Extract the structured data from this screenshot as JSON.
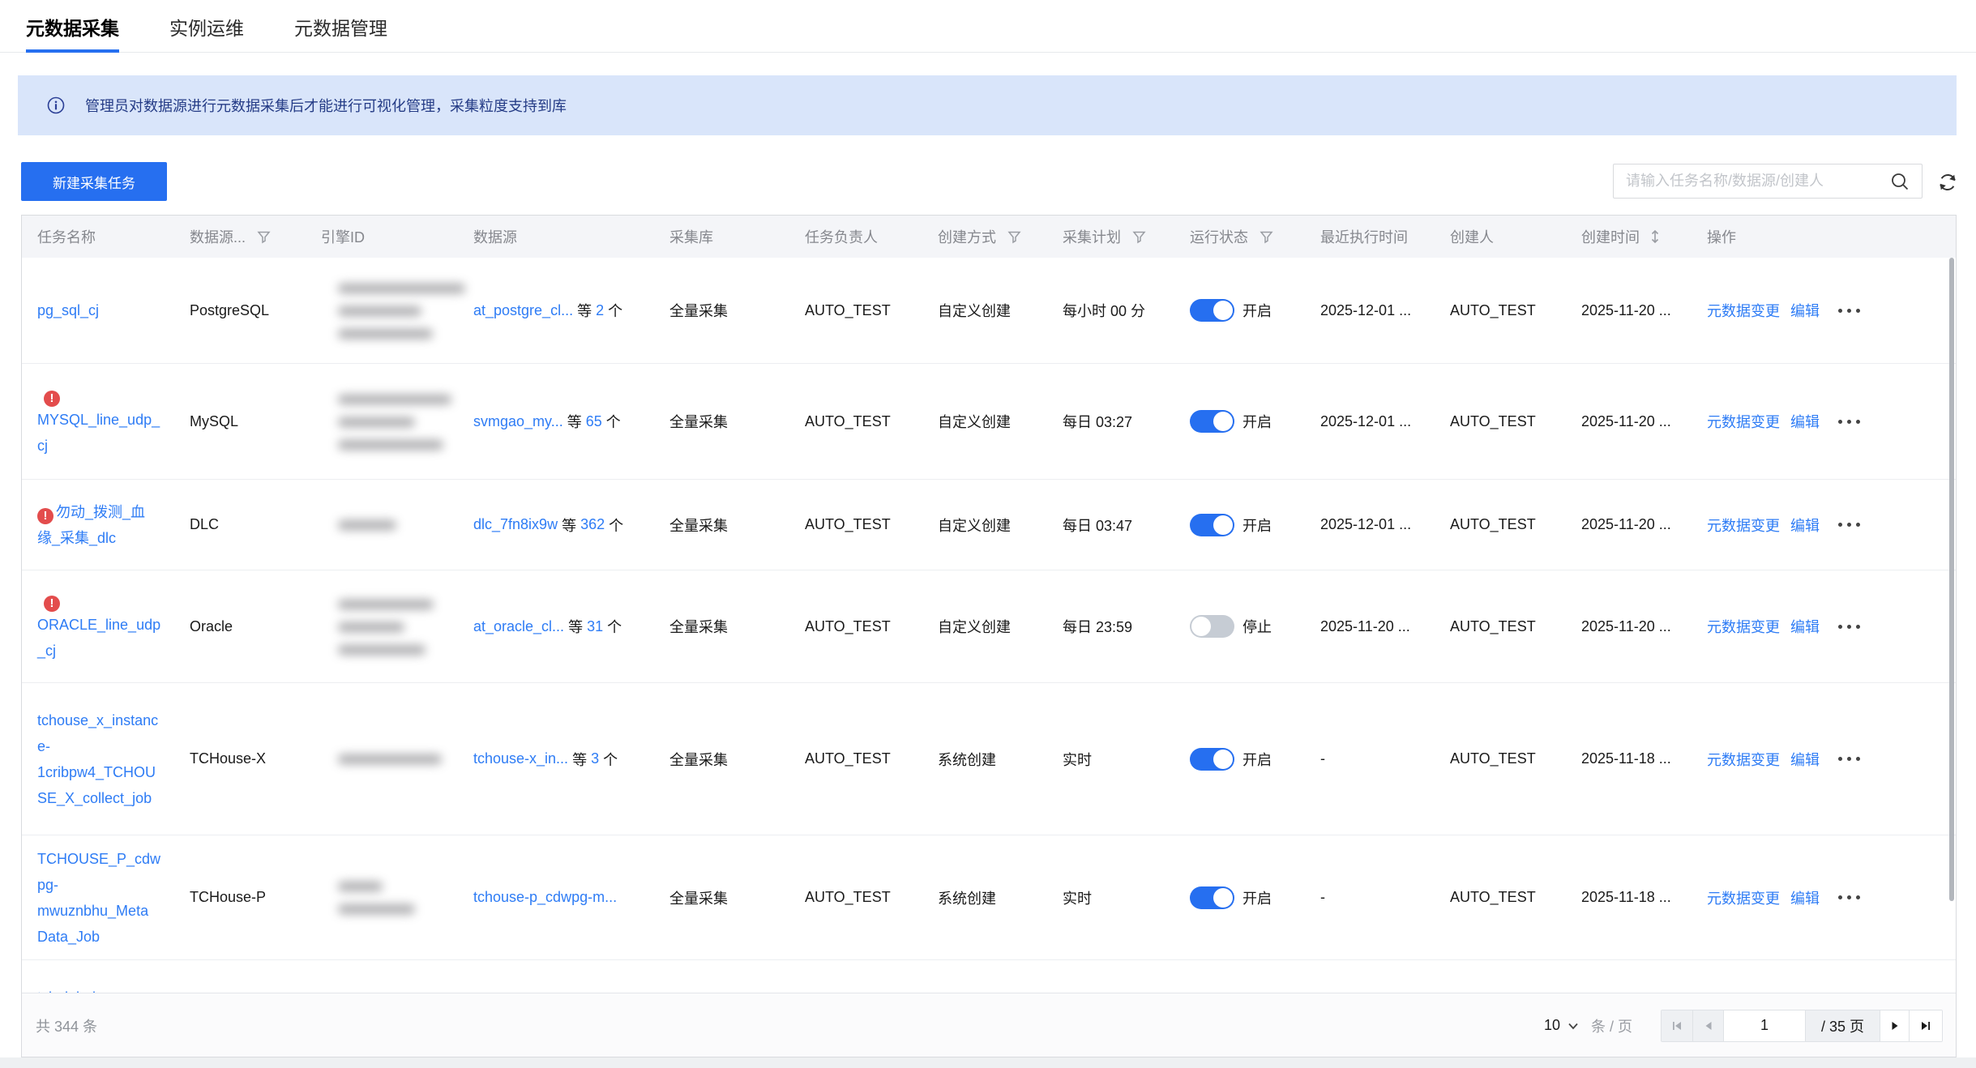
{
  "tabs": [
    {
      "label": "元数据采集",
      "active": true
    },
    {
      "label": "实例运维",
      "active": false
    },
    {
      "label": "元数据管理",
      "active": false
    }
  ],
  "banner": {
    "text": "管理员对数据源进行元数据采集后才能进行可视化管理，采集粒度支持到库"
  },
  "toolbar": {
    "new_task_label": "新建采集任务",
    "search_placeholder": "请输入任务名称/数据源/创建人"
  },
  "table": {
    "columns": [
      {
        "label": "任务名称"
      },
      {
        "label": "数据源...",
        "filter": true
      },
      {
        "label": "引擎ID"
      },
      {
        "label": "数据源"
      },
      {
        "label": "采集库"
      },
      {
        "label": "任务负责人"
      },
      {
        "label": "创建方式",
        "filter": true
      },
      {
        "label": "采集计划",
        "filter": true
      },
      {
        "label": "运行状态",
        "filter": true
      },
      {
        "label": "最近执行时间"
      },
      {
        "label": "创建人"
      },
      {
        "label": "创建时间",
        "sort": true
      },
      {
        "label": "操作"
      }
    ],
    "source_prefix": "等",
    "source_unit": "个",
    "ops": [
      "元数据变更",
      "编辑"
    ],
    "rows": [
      {
        "name": "pg_sql_cj",
        "error": "none",
        "type": "PostgreSQL",
        "blur": [
          157,
          103,
          117
        ],
        "source": "at_postgre_cl...",
        "count": "2",
        "db": "全量采集",
        "owner": "AUTO_TEST",
        "mode": "自定义创建",
        "plan": "每小时 00 分",
        "status_on": true,
        "status": "开启",
        "last": "2025-12-01 ...",
        "creator": "AUTO_TEST",
        "created": "2025-11-20 ..."
      },
      {
        "name": "MYSQL_line_udp_\ncj",
        "error": "above",
        "type": "MySQL",
        "blur": [
          140,
          95,
          130
        ],
        "source": "svmgao_my...",
        "count": "65",
        "db": "全量采集",
        "owner": "AUTO_TEST",
        "mode": "自定义创建",
        "plan": "每日 03:27",
        "status_on": true,
        "status": "开启",
        "last": "2025-12-01 ...",
        "creator": "AUTO_TEST",
        "created": "2025-11-20 ..."
      },
      {
        "name": "勿动_拨测_血\n缘_采集_dlc",
        "error": "inline",
        "type": "DLC",
        "blur": [
          72
        ],
        "source": "dlc_7fn8ix9w",
        "count": "362",
        "db": "全量采集",
        "owner": "AUTO_TEST",
        "mode": "自定义创建",
        "plan": "每日 03:47",
        "status_on": true,
        "status": "开启",
        "last": "2025-12-01 ...",
        "creator": "AUTO_TEST",
        "created": "2025-11-20 ..."
      },
      {
        "name": "ORACLE_line_udp\n_cj",
        "error": "above",
        "type": "Oracle",
        "blur": [
          118,
          82,
          108
        ],
        "source": "at_oracle_cl...",
        "count": "31",
        "db": "全量采集",
        "owner": "AUTO_TEST",
        "mode": "自定义创建",
        "plan": "每日 23:59",
        "status_on": false,
        "status": "停止",
        "last": "2025-11-20 ...",
        "creator": "AUTO_TEST",
        "created": "2025-11-20 ..."
      },
      {
        "name": "tchouse_x_instanc\ne-\n1cribpw4_TCHOU\nSE_X_collect_job",
        "error": "none",
        "type": "TCHouse-X",
        "blur": [
          128
        ],
        "source": "tchouse-x_in...",
        "count": "3",
        "db": "全量采集",
        "owner": "AUTO_TEST",
        "mode": "系统创建",
        "plan": "实时",
        "status_on": true,
        "status": "开启",
        "last": "-",
        "creator": "AUTO_TEST",
        "created": "2025-11-18 ..."
      },
      {
        "name": "TCHOUSE_P_cdw\npg-\nmwuznbhu_Meta\nData_Job",
        "error": "none",
        "type": "TCHouse-P",
        "blur": [
          55,
          95
        ],
        "source": "tchouse-p_cdwpg-m...",
        "count": null,
        "db": "全量采集",
        "owner": "AUTO_TEST",
        "mode": "系统创建",
        "plan": "实时",
        "status_on": true,
        "status": "开启",
        "last": "-",
        "creator": "AUTO_TEST",
        "created": "2025-11-18 ..."
      }
    ],
    "partial_row_name": "tch_job_l"
  },
  "footer": {
    "total_text": "共 344 条",
    "page_size": "10",
    "per_page_label": "条 / 页",
    "current_page": "1",
    "total_pages_label": "/ 35 页"
  }
}
